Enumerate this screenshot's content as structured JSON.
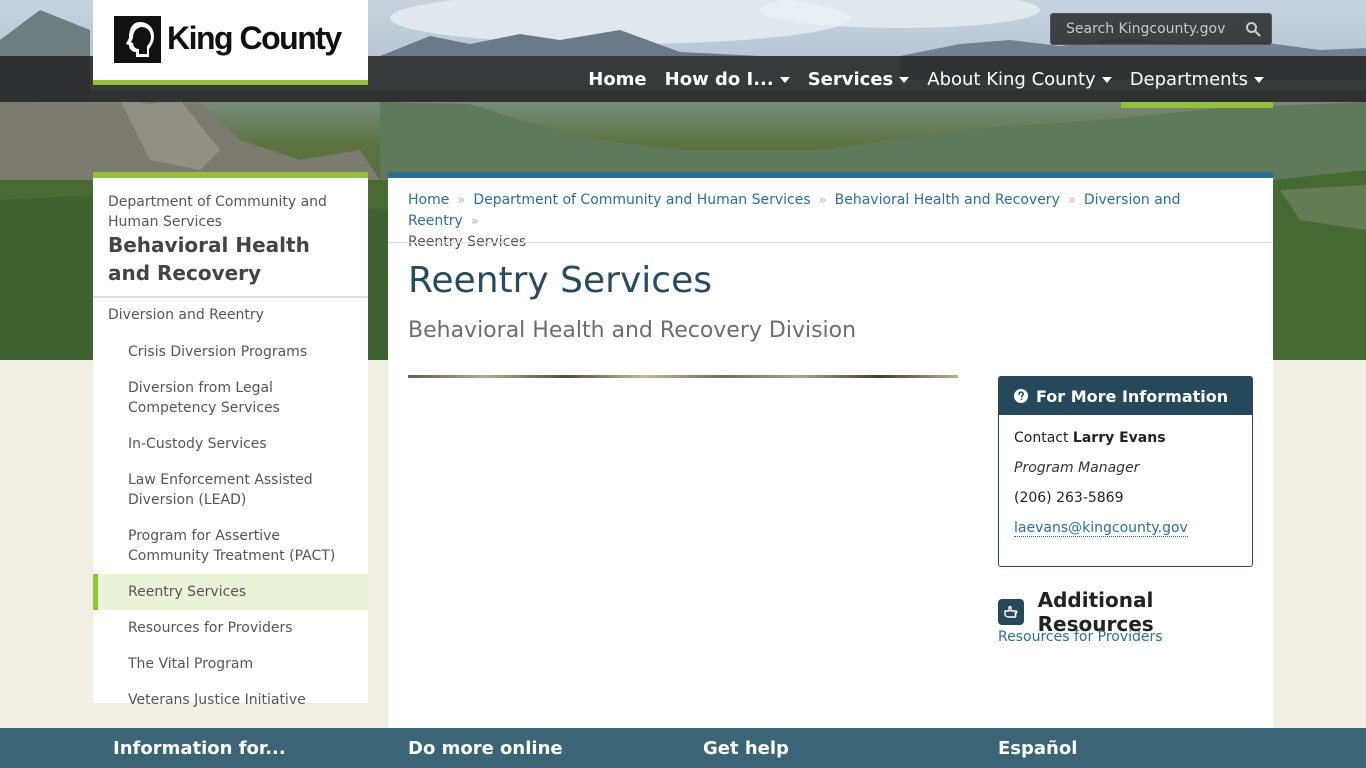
{
  "header": {
    "logo_text": "King County",
    "search_placeholder": "Search Kingcounty.gov"
  },
  "nav": {
    "items": [
      {
        "label": "Home",
        "bold": true,
        "caret": false,
        "active": false
      },
      {
        "label": "How do I...",
        "bold": true,
        "caret": true,
        "active": false
      },
      {
        "label": "Services",
        "bold": true,
        "caret": true,
        "active": false
      },
      {
        "label": "About King County",
        "bold": false,
        "caret": true,
        "active": false
      },
      {
        "label": "Departments",
        "bold": false,
        "caret": true,
        "active": true
      }
    ]
  },
  "sidebar": {
    "parent": "Department of Community and Human Services",
    "title": "Behavioral Health and Recovery",
    "section": "Diversion and Reentry",
    "items": [
      "Crisis Diversion Programs",
      "Diversion from Legal Competency Services",
      "In-Custody Services",
      "Law Enforcement Assisted Diversion (LEAD)",
      "Program for Assertive Community Treatment (PACT)",
      "Reentry Services",
      "Resources for Providers",
      "The Vital Program",
      "Veterans Justice Initiative"
    ],
    "active_item": "Reentry Services"
  },
  "breadcrumb": {
    "links": [
      "Home",
      "Department of Community and Human Services",
      "Behavioral Health and Recovery",
      "Diversion and Reentry"
    ],
    "current": "Reentry Services"
  },
  "main": {
    "title": "Reentry Services",
    "subtitle": "Behavioral Health and Recovery Division"
  },
  "info_box": {
    "heading": "For More Information",
    "contact_prefix": "Contact",
    "contact_name": "Larry Evans",
    "role": "Program Manager",
    "phone": "(206) 263-5869",
    "email": "laevans@kingcounty.gov"
  },
  "resources": {
    "heading": "Additional Resources",
    "link": "Resources for Providers"
  },
  "footer": {
    "col1": "Information for...",
    "col2": "Do more online",
    "col3": "Get help",
    "col4": "Español"
  },
  "colors": {
    "accent_green": "#93c13e",
    "primary_blue": "#2d6f8d",
    "dark_blue": "#26485c",
    "footer_blue": "#3b6476"
  }
}
